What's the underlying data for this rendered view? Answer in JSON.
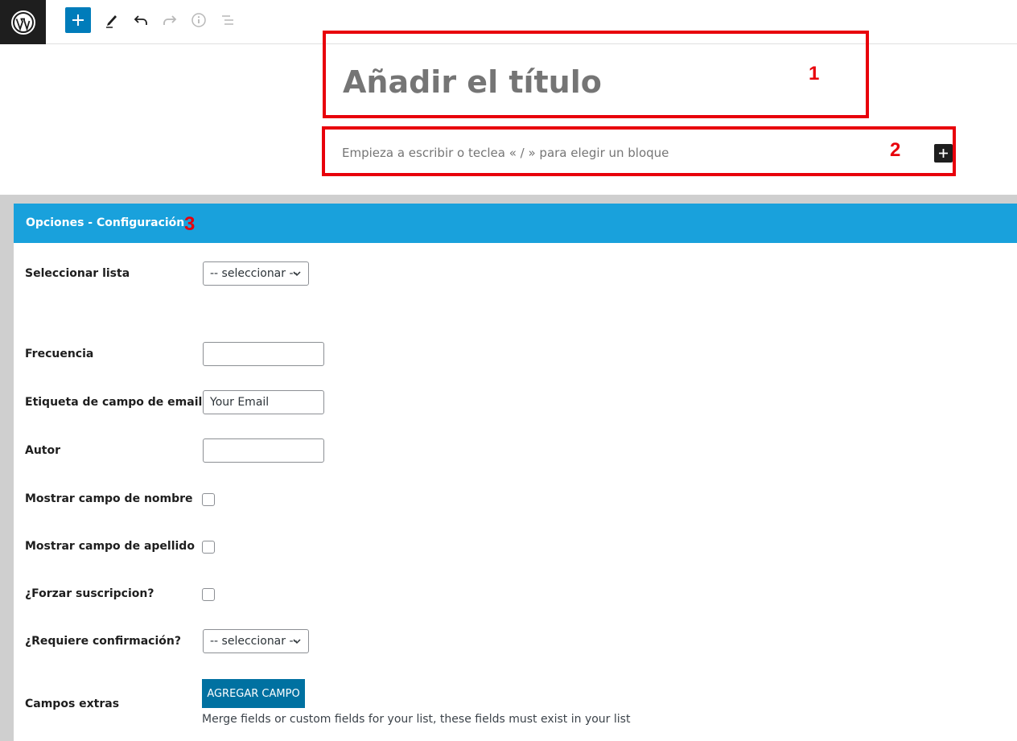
{
  "editor": {
    "title_placeholder": "Añadir el título",
    "block_placeholder": "Empieza a escribir o teclea « / » para elegir un bloque"
  },
  "annotations": [
    "1",
    "2",
    "3"
  ],
  "meta_box": {
    "title": "Opciones - Configuración",
    "fields": {
      "select_list": {
        "label": "Seleccionar lista",
        "value": "-- seleccionar --"
      },
      "frequency": {
        "label": "Frecuencia",
        "value": ""
      },
      "email_label": {
        "label": "Etiqueta de campo de email",
        "value": "Your Email"
      },
      "author": {
        "label": "Autor",
        "value": ""
      },
      "show_name": {
        "label": "Mostrar campo de nombre",
        "checked": false
      },
      "show_lastname": {
        "label": "Mostrar campo de apellido",
        "checked": false
      },
      "force_sub": {
        "label": "¿Forzar suscripcion?",
        "checked": false
      },
      "confirm": {
        "label": "¿Requiere confirmación?",
        "value": "-- seleccionar --"
      },
      "extra_fields": {
        "label": "Campos extras",
        "button_label": "AGREGAR CAMPO",
        "help": "Merge fields or custom fields for your list, these fields must exist in your list"
      }
    }
  },
  "colors": {
    "accent": "#007cba",
    "header_blue": "#19a1dc",
    "annotation_red": "#e8000b",
    "button_blue": "#0071a1"
  },
  "icons": {
    "logo": "wordpress-icon",
    "add": "plus-icon",
    "edit": "pencil-icon",
    "undo": "undo-icon",
    "redo": "redo-icon",
    "info": "info-icon",
    "outline": "list-view-icon"
  }
}
